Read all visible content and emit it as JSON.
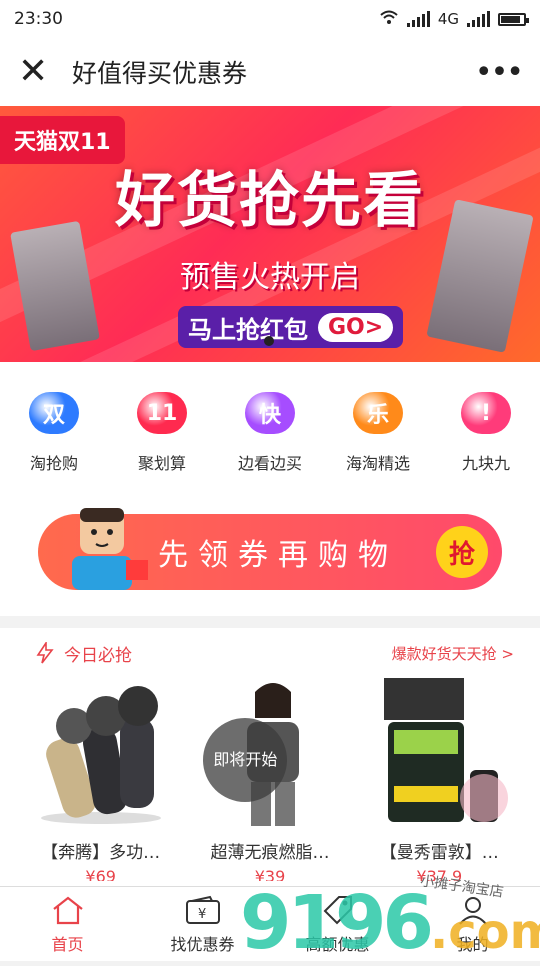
{
  "status": {
    "time": "23:30",
    "network": "4G",
    "battery_level": 0.85
  },
  "navbar": {
    "title": "好值得买优惠券",
    "close_icon": "close-icon",
    "more_icon": "more-icon"
  },
  "banner": {
    "tag": "天猫双11",
    "headline": "好货抢先看",
    "subline": "预售火热开启",
    "button_label": "马上抢红包",
    "go_label": "GO>"
  },
  "categories": [
    {
      "label": "淘抢购",
      "glyph": "双",
      "color": "#2e7bff"
    },
    {
      "label": "聚划算",
      "glyph": "11",
      "color": "#ff2a4f"
    },
    {
      "label": "边看边买",
      "glyph": "快",
      "color": "#a64dff"
    },
    {
      "label": "海淘精选",
      "glyph": "乐",
      "color": "#ff8a1a"
    },
    {
      "label": "九块九",
      "glyph": "!",
      "color": "#ff3b7a"
    }
  ],
  "coupon_banner": {
    "text": "先领券再购物",
    "button": "抢"
  },
  "today": {
    "title": "今日必抢",
    "more": "爆款好货天天抢 >",
    "products": [
      {
        "name": "【奔腾】多功…",
        "price": "¥69"
      },
      {
        "name": "超薄无痕燃脂…",
        "price": "¥39",
        "badge": "即将开始"
      },
      {
        "name": "【曼秀雷敦】…",
        "price": "¥37.9"
      }
    ]
  },
  "tabbar": {
    "items": [
      {
        "label": "首页",
        "icon": "home-icon",
        "active": true
      },
      {
        "label": "找优惠券",
        "icon": "wallet-icon",
        "active": false
      },
      {
        "label": "高额优惠",
        "icon": "tag-icon",
        "active": false
      },
      {
        "label": "我的",
        "icon": "user-icon",
        "active": false
      }
    ]
  },
  "watermark": {
    "text": "9196",
    "suffix": ".com",
    "handwriting": "小摊子淘宝店"
  }
}
